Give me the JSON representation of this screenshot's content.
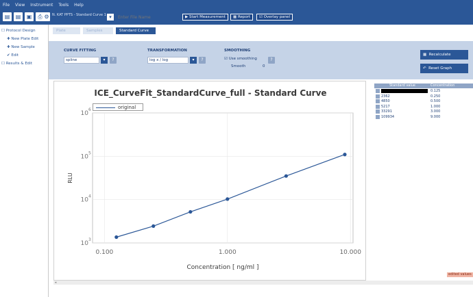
{
  "menu": [
    "File",
    "View",
    "Instrument",
    "Tools",
    "Help"
  ],
  "toolbar": {
    "kit_label": "N. KAT PPTS - Standard Curve 1",
    "file_name_placeholder": "Enter File Name",
    "start_label": "Start Measurement",
    "report_label": "Report",
    "overlay_label": "Overlay panel"
  },
  "left_tree": [
    {
      "label": "Protocol Design",
      "icon": "folder-icon"
    },
    {
      "label": "New Plate Edit",
      "icon": "plus-icon"
    },
    {
      "label": "New Sample",
      "icon": "plus-icon"
    },
    {
      "label": "Edit",
      "icon": "check-icon"
    },
    {
      "label": "Results & Edit",
      "icon": "folder-icon"
    }
  ],
  "tabs": [
    "Plate",
    "Samples",
    "Standard Curve"
  ],
  "settings": {
    "curve_fitting": {
      "title": "CURVE FITTING",
      "value": "spline"
    },
    "transformation": {
      "title": "TRANSFORMATION",
      "value": "log x / log"
    },
    "smoothing": {
      "title": "SMOOTHING",
      "checkbox_label": "Use smoothing",
      "smooth_label": "Smooth",
      "smooth_value": "0"
    },
    "recalculate_label": "Recalculate",
    "reset_label": "Reset Graph"
  },
  "chart_data": {
    "type": "line",
    "title": "ICE_CurveFit_StandardCurve_full - Standard Curve",
    "xlabel": "Concentration [ ng/ml ]",
    "ylabel": "RLU",
    "xscale": "log",
    "yscale": "log",
    "xlim": [
      0.08,
      10.5
    ],
    "ylim": [
      1000,
      1000000
    ],
    "x_ticks": [
      "0.100",
      "1.000",
      "10.000"
    ],
    "y_ticks": [
      "10",
      "10",
      "10",
      "10"
    ],
    "y_tick_exponents": [
      "3",
      "4",
      "5",
      "6"
    ],
    "series": [
      {
        "name": "original",
        "x": [
          0.125,
          0.25,
          0.5,
          1.0,
          3.0,
          9.0
        ],
        "y": [
          1362,
          2450,
          5217,
          10290,
          35020,
          109934
        ]
      }
    ],
    "legend": "top-left",
    "grid": false,
    "color": "#2b5797"
  },
  "table": {
    "headers": [
      "Standard value",
      "Concentration"
    ],
    "rows": [
      {
        "value": "",
        "conc": "0.125"
      },
      {
        "value": "2362",
        "conc": "0.250"
      },
      {
        "value": "4850",
        "conc": "0.500"
      },
      {
        "value": "5217",
        "conc": "1.000"
      },
      {
        "value": "33291",
        "conc": "3.000"
      },
      {
        "value": "109934",
        "conc": "9.000"
      }
    ]
  },
  "edited_note": "edited values"
}
